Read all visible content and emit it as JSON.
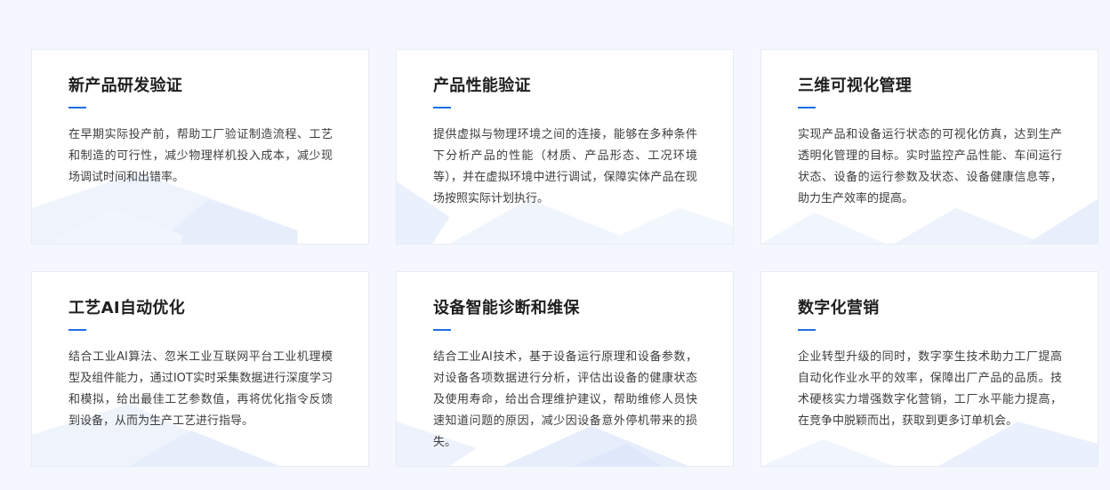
{
  "cards": [
    {
      "title": "新产品研发验证",
      "description": "在早期实际投产前，帮助工厂验证制造流程、工艺和制造的可行性，减少物理样机投入成本，减少现场调试时间和出错率。"
    },
    {
      "title": "产品性能验证",
      "description": "提供虚拟与物理环境之间的连接，能够在多种条件下分析产品的性能（材质、产品形态、工况环境等），并在虚拟环境中进行调试，保障实体产品在现场按照实际计划执行。"
    },
    {
      "title": "三维可视化管理",
      "description": "实现产品和设备运行状态的可视化仿真，达到生产透明化管理的目标。实时监控产品性能、车间运行状态、设备的运行参数及状态、设备健康信息等，助力生产效率的提高。"
    },
    {
      "title": "工艺AI自动优化",
      "description": "结合工业AI算法、忽米工业互联网平台工业机理模型及组件能力，通过IOT实时采集数据进行深度学习和模拟，给出最佳工艺参数值，再将优化指令反馈到设备，从而为生产工艺进行指导。"
    },
    {
      "title": "设备智能诊断和维保",
      "description": "结合工业AI技术，基于设备运行原理和设备参数，对设备各项数据进行分析，评估出设备的健康状态及使用寿命，给出合理维护建议，帮助维修人员快速知道问题的原因，减少因设备意外停机带来的损失。"
    },
    {
      "title": "数字化营销",
      "description": "企业转型升级的同时，数字孪生技术助力工厂提高自动化作业水平的效率，保障出厂产品的品质。技术硬核实力增强数字化营销，工厂水平能力提高，在竞争中脱颖而出，获取到更多订单机会。"
    }
  ],
  "colors": {
    "accent": "#1f6ee6",
    "title": "#1f1f1f",
    "text": "#3d3d3d",
    "background": "#f4f7fd",
    "card": "#ffffff"
  }
}
